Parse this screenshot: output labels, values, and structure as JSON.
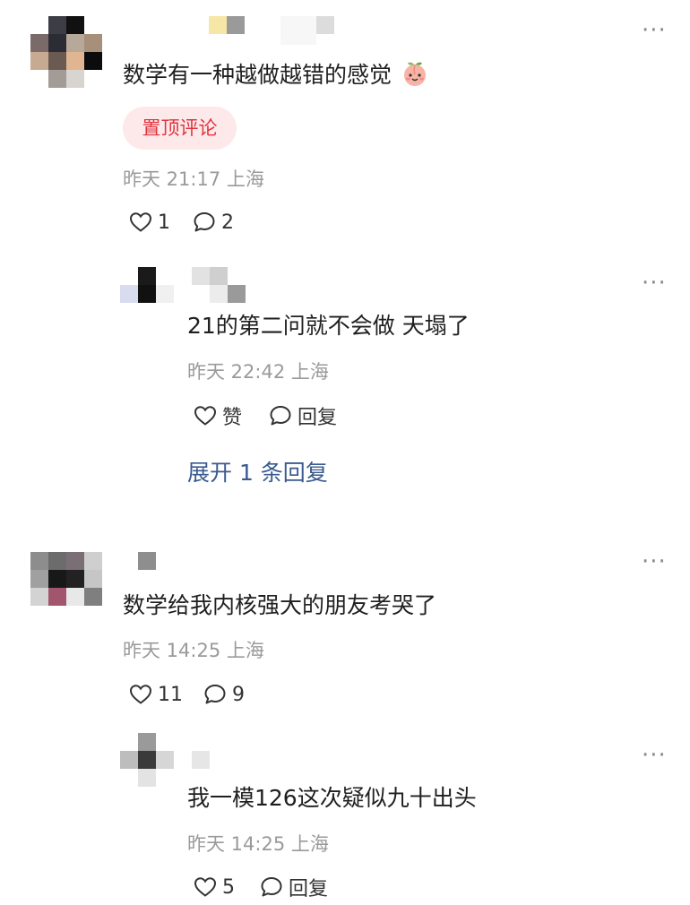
{
  "colors": {
    "accent_red": "#e0343e",
    "tag_bg": "#fde9ea",
    "link_blue": "#3a5a8e",
    "meta_gray": "#9a9a9a"
  },
  "comments": [
    {
      "text": "数学有一种越做越错的感觉",
      "emoji": "peach-face-emoji",
      "tag": "置顶评论",
      "meta": "昨天 21:17 上海",
      "likes": "1",
      "replies_count": "2",
      "reply": {
        "text": "21的第二问就不会做 天塌了",
        "meta": "昨天 22:42 上海",
        "like_label": "赞",
        "reply_label": "回复"
      },
      "expand_label": "展开 1 条回复"
    },
    {
      "text": "数学给我内核强大的朋友考哭了",
      "meta": "昨天 14:25 上海",
      "likes": "11",
      "replies_count": "9",
      "reply": {
        "text": "我一模126这次疑似九十出头",
        "meta": "昨天 14:25 上海",
        "likes": "5",
        "reply_label": "回复"
      }
    }
  ],
  "icons": {
    "more": "more-options-icon",
    "heart": "heart-outline-icon",
    "bubble": "comment-bubble-icon"
  }
}
